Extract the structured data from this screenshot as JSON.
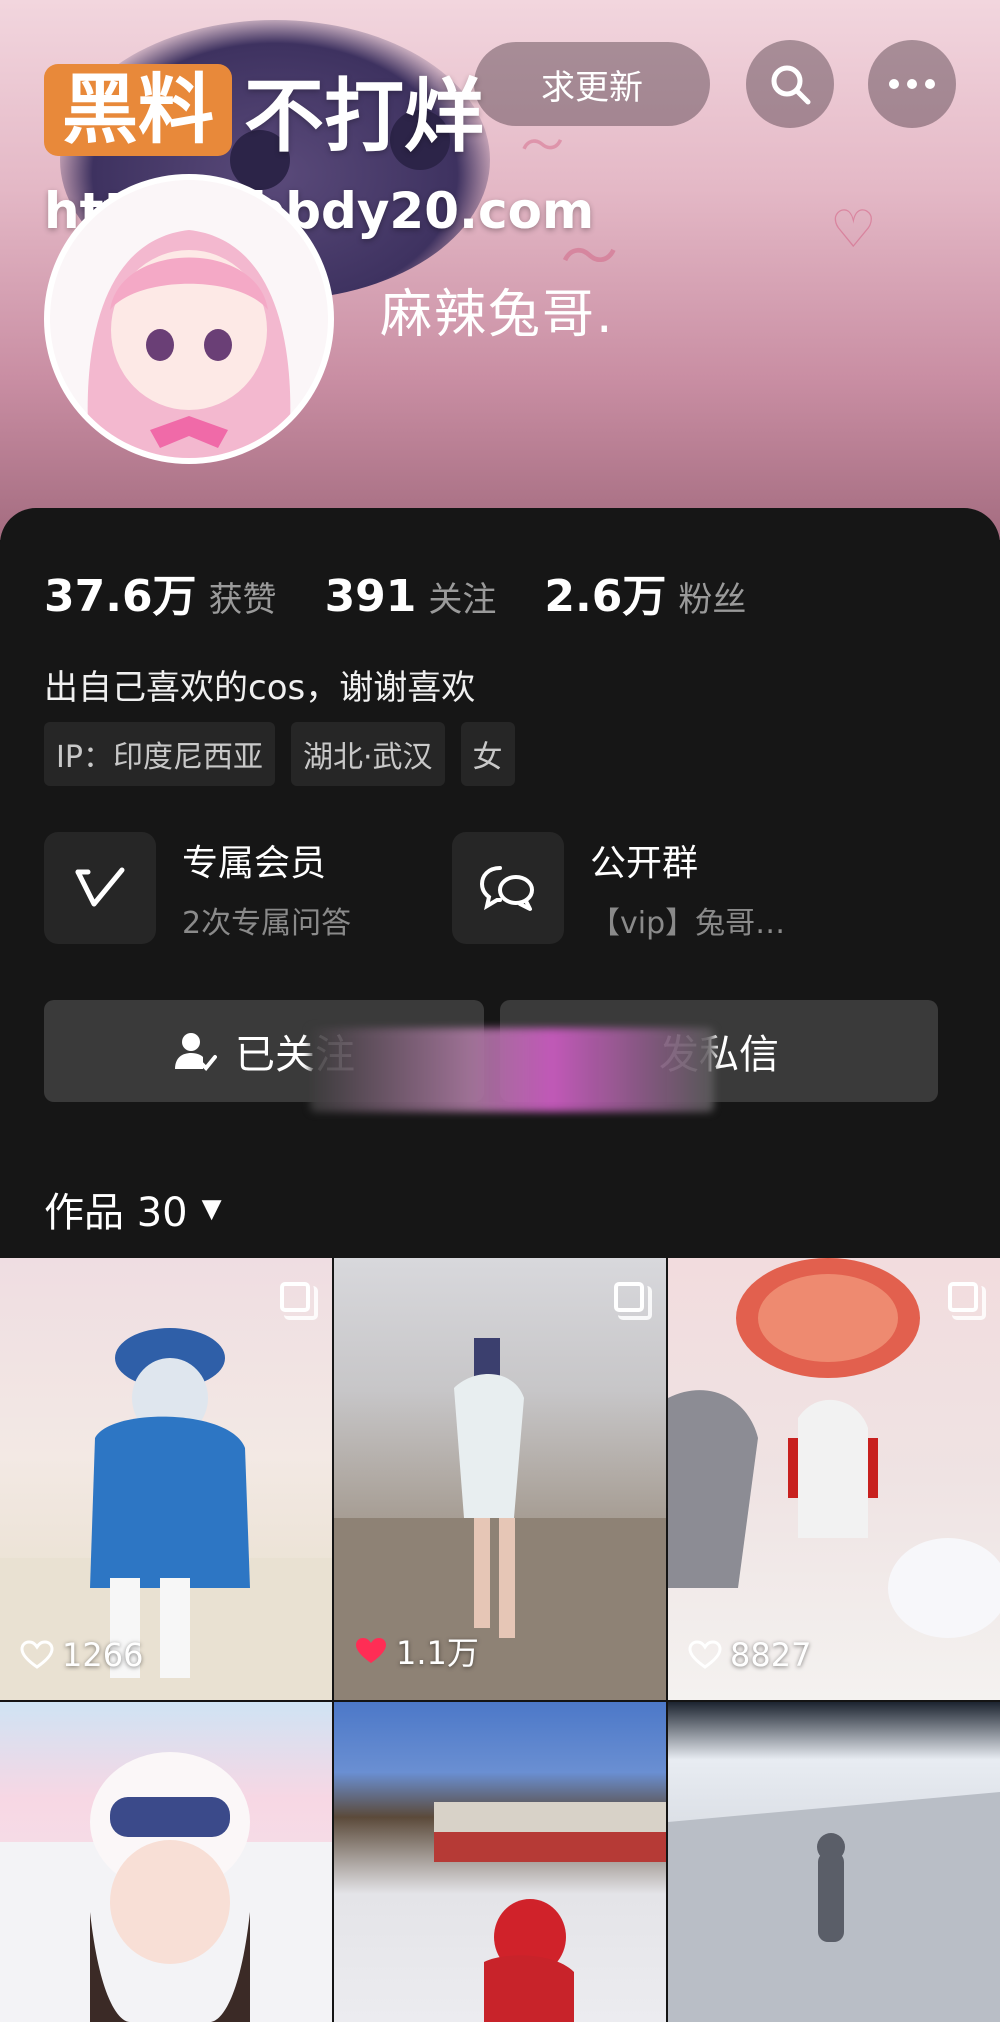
{
  "header": {
    "watermark_box": "黑料",
    "watermark_text": "不打烊",
    "watermark_url": "https://bbdy20.com",
    "update_pill": "求更新",
    "username": "麻辣兔哥."
  },
  "stats": [
    {
      "value": "37.6万",
      "label": "获赞"
    },
    {
      "value": "391",
      "label": "关注"
    },
    {
      "value": "2.6万",
      "label": "粉丝"
    }
  ],
  "bio": "出自己喜欢的cos，谢谢喜欢",
  "tags": [
    "IP：印度尼西亚",
    "湖北·武汉",
    "女"
  ],
  "features": [
    {
      "title": "专属会员",
      "subtitle": "2次专属问答"
    },
    {
      "title": "公开群",
      "subtitle": "【vip】兔哥…"
    }
  ],
  "actions": {
    "follow": "已关注",
    "message": "发私信"
  },
  "works": {
    "label": "作品 30"
  },
  "grid": [
    {
      "likes": "1266",
      "liked": false
    },
    {
      "likes": "1.1万",
      "liked": true
    },
    {
      "likes": "8827",
      "liked": false
    },
    {
      "likes": "",
      "liked": false
    },
    {
      "likes": "",
      "liked": false
    },
    {
      "likes": "",
      "liked": false
    }
  ],
  "colors": {
    "accent": "#e8893a",
    "like_red": "#ff2d55",
    "card_bg": "#161616"
  }
}
